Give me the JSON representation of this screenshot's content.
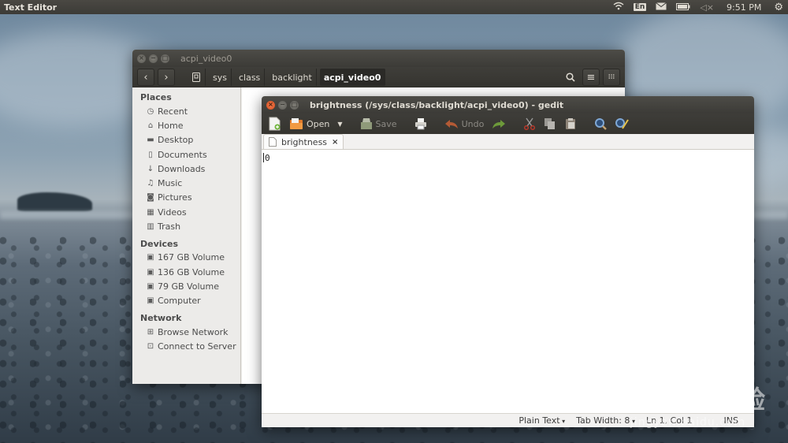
{
  "top_panel": {
    "app_title": "Text Editor",
    "keyboard_layout": "En",
    "clock": "9:51 PM",
    "icons": [
      "wifi-icon",
      "keyboard-layout-icon",
      "mail-icon",
      "battery-icon",
      "volume-mute-icon",
      "settings-gear-icon"
    ]
  },
  "files_window": {
    "title": "acpi_video0",
    "breadcrumbs": [
      "sys",
      "class",
      "backlight",
      "acpi_video0"
    ],
    "active_crumb": "acpi_video0",
    "sidebar": {
      "places_title": "Places",
      "places": [
        {
          "label": "Recent",
          "icon": "clock-icon"
        },
        {
          "label": "Home",
          "icon": "home-icon"
        },
        {
          "label": "Desktop",
          "icon": "folder-icon"
        },
        {
          "label": "Documents",
          "icon": "document-icon"
        },
        {
          "label": "Downloads",
          "icon": "download-icon"
        },
        {
          "label": "Music",
          "icon": "music-icon"
        },
        {
          "label": "Pictures",
          "icon": "camera-icon"
        },
        {
          "label": "Videos",
          "icon": "film-icon"
        },
        {
          "label": "Trash",
          "icon": "trash-icon"
        }
      ],
      "devices_title": "Devices",
      "devices": [
        {
          "label": "167 GB Volume",
          "icon": "drive-icon"
        },
        {
          "label": "136 GB Volume",
          "icon": "drive-icon"
        },
        {
          "label": "79 GB Volume",
          "icon": "drive-icon"
        },
        {
          "label": "Computer",
          "icon": "drive-icon"
        }
      ],
      "network_title": "Network",
      "network": [
        {
          "label": "Browse Network",
          "icon": "network-icon"
        },
        {
          "label": "Connect to Server",
          "icon": "server-icon"
        }
      ]
    }
  },
  "gedit_window": {
    "title": "brightness (/sys/class/backlight/acpi_video0) - gedit",
    "toolbar": {
      "open_label": "Open",
      "save_label": "Save",
      "undo_label": "Undo"
    },
    "tab_label": "brightness",
    "content": "0",
    "status": {
      "language": "Plain Text",
      "tab_width": "Tab Width: 8",
      "position": "Ln 1, Col 1",
      "mode": "INS"
    }
  },
  "watermark": {
    "logo": "Bai du 经验",
    "url": "jingyan.baidu.com"
  }
}
